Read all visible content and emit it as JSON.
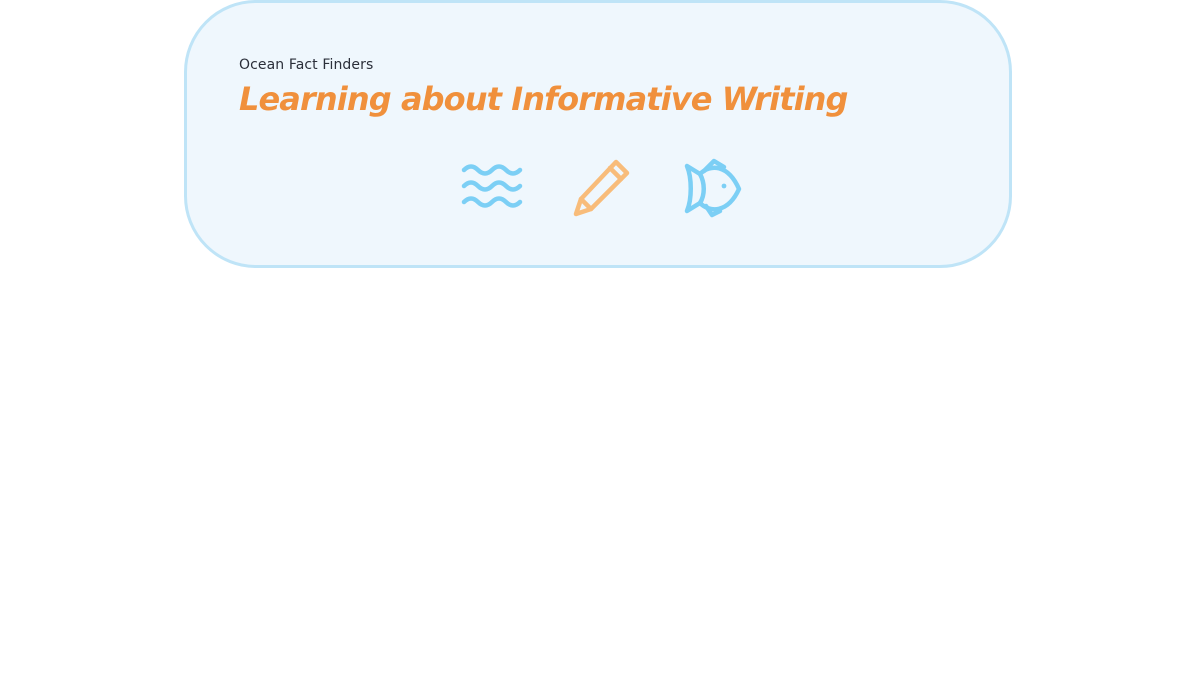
{
  "banner": {
    "subtitle": "Ocean Fact Finders",
    "title": "Learning about Informative Writing"
  },
  "icons": [
    "waves-icon",
    "pencil-icon",
    "fish-icon"
  ],
  "colors": {
    "card_background": "#eff7fd",
    "card_border": "#bfe4f7",
    "title": "#f0903c",
    "subtitle": "#2b2f3a",
    "icon_blue": "#7ccff5",
    "icon_orange": "#f8bc7a"
  }
}
